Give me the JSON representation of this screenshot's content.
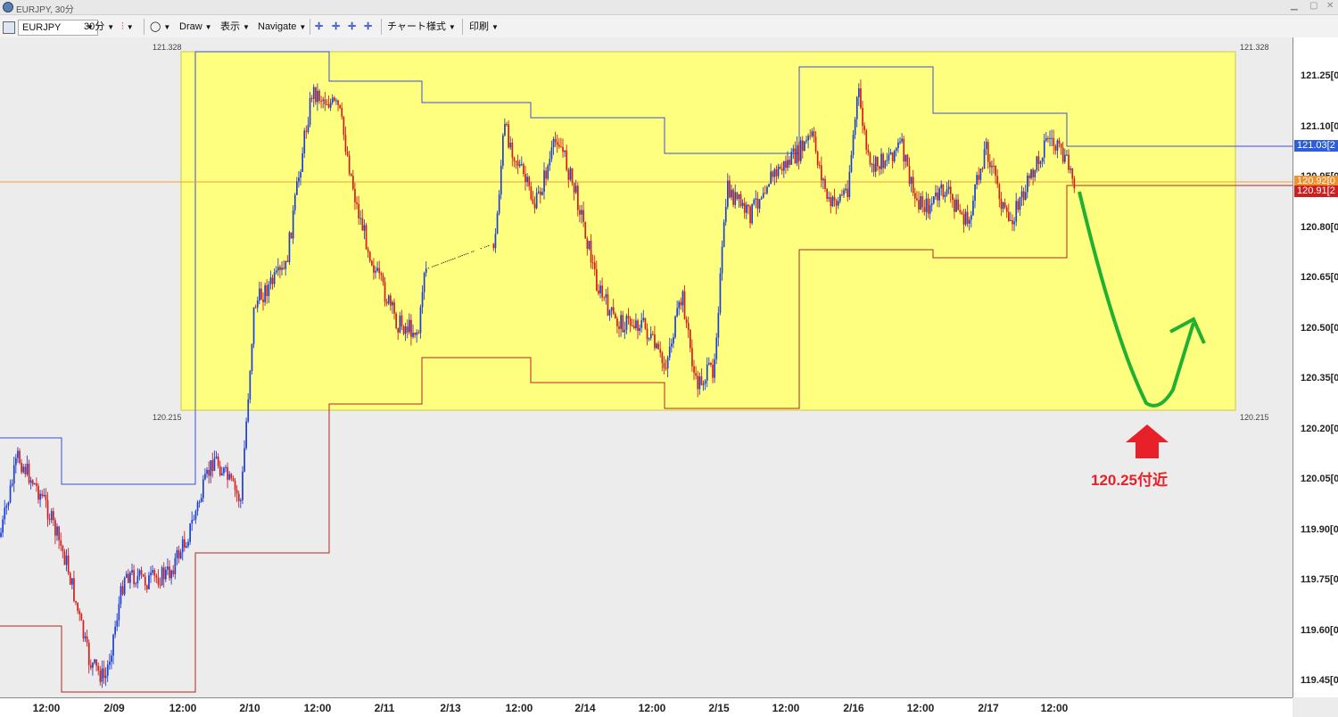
{
  "window": {
    "title": "EURJPY, 30分"
  },
  "toolbar": {
    "symbol": "EURJPY",
    "timeframe": "30分",
    "draw": "Draw",
    "view": "表示",
    "navigate": "Navigate",
    "chart_style": "チャート様式",
    "print": "印刷"
  },
  "colors": {
    "up": "#1f3fd0",
    "down": "#d11f1f",
    "zone": "#ffff7f",
    "upper_channel": "#3a4fd8",
    "lower_channel": "#b22626",
    "crosshair": "#f0a030",
    "arrow_green": "#22b030",
    "arrow_red": "#e8202a"
  },
  "range_box": {
    "high_label": "121.328",
    "low_label": "120.215",
    "high": 121.328,
    "low": 120.215
  },
  "price_axis": {
    "labels": [
      "121.25[0",
      "121.10[0",
      "120.95[0",
      "120.80[0",
      "120.65[0",
      "120.50[0",
      "120.35[0",
      "120.20[0",
      "120.05[0",
      "119.90[0",
      "119.75[0",
      "119.60[0",
      "119.45[0"
    ],
    "values": [
      121.25,
      121.1,
      120.95,
      120.8,
      120.65,
      120.5,
      120.35,
      120.2,
      120.05,
      119.9,
      119.75,
      119.6,
      119.45
    ],
    "badge_blue": "121.03[2",
    "badge_orange": "120.92[0",
    "badge_red": "120.91[2"
  },
  "time_axis": [
    "12:00",
    "2/09",
    "12:00",
    "2/10",
    "12:00",
    "2/11",
    "2/13",
    "12:00",
    "2/14",
    "12:00",
    "2/15",
    "12:00",
    "2/16",
    "12:00",
    "2/17",
    "12:00"
  ],
  "annotation": {
    "text": "120.25付近",
    "target_price": 120.25
  }
}
